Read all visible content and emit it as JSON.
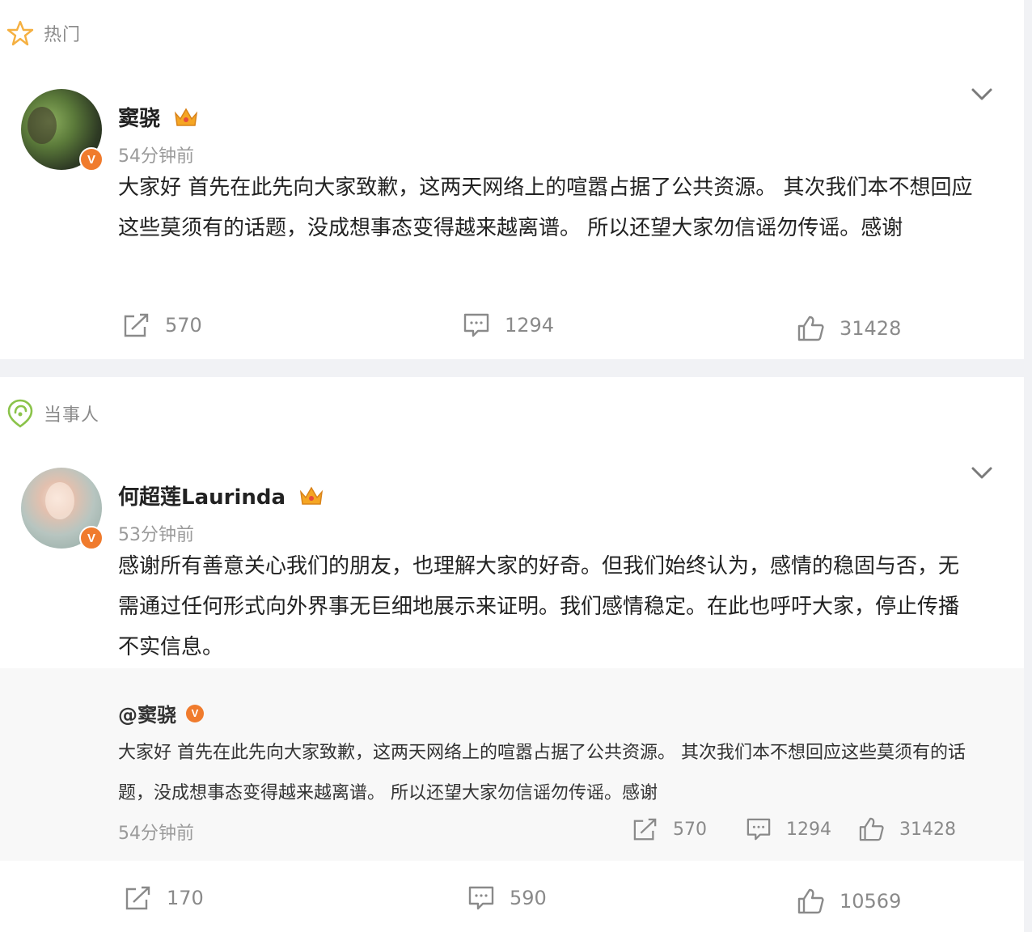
{
  "sections": {
    "hot_label": "热门",
    "party_label": "当事人"
  },
  "post1": {
    "username": "窦骁",
    "time": "54分钟前",
    "content": "大家好 首先在此先向大家致歉，这两天网络上的喧嚣占据了公共资源。 其次我们本不想回应这些莫须有的话题，没成想事态变得越来越离谱。 所以还望大家勿信谣勿传谣。感谢",
    "verified": "V",
    "reposts": "570",
    "comments": "1294",
    "likes": "31428"
  },
  "post2": {
    "username": "何超莲Laurinda",
    "time": "53分钟前",
    "content": "感谢所有善意关心我们的朋友，也理解大家的好奇。但我们始终认为，感情的稳固与否，无需通过任何形式向外界事无巨细地展示来证明。我们感情稳定。在此也呼吁大家，停止传播不实信息。",
    "verified": "V",
    "quote": {
      "username": "@窦骁",
      "verified": "V",
      "content": "大家好 首先在此先向大家致歉，这两天网络上的喧嚣占据了公共资源。 其次我们本不想回应这些莫须有的话题，没成想事态变得越来越离谱。 所以还望大家勿信谣勿传谣。感谢",
      "time": "54分钟前",
      "reposts": "570",
      "comments": "1294",
      "likes": "31428"
    },
    "reposts": "170",
    "comments": "590",
    "likes": "10569"
  },
  "colors": {
    "verified_badge": "#f07b2d",
    "star_icon": "#f5b041",
    "party_icon": "#8bc34a",
    "crown": "#f5a623",
    "muted_text": "#8a8a8a"
  },
  "icons": [
    "star-icon",
    "party-icon",
    "crown-icon",
    "chevron-down-icon",
    "repost-icon",
    "comment-icon",
    "like-icon"
  ]
}
